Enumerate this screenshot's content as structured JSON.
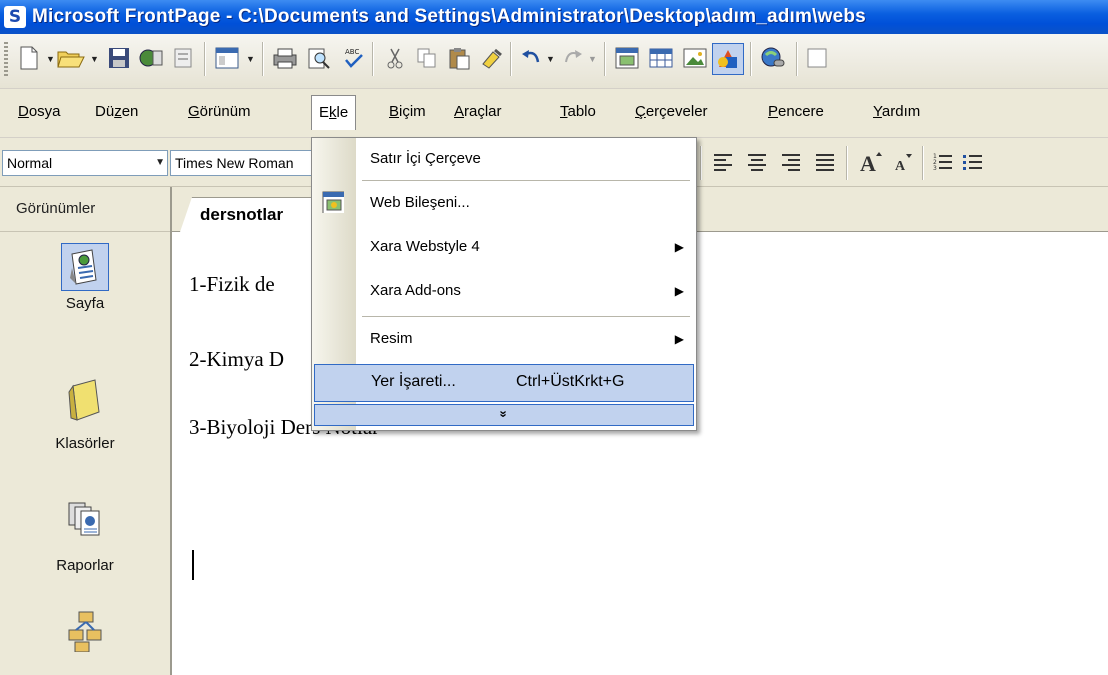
{
  "window": {
    "title": "Microsoft FrontPage - C:\\Documents and Settings\\Administrator\\Desktop\\adım_adım\\webs"
  },
  "menubar": {
    "items": [
      {
        "label": "Dosya",
        "u": "D"
      },
      {
        "label": "Düzen",
        "u": "z"
      },
      {
        "label": "Görünüm",
        "u": "G"
      },
      {
        "label": "Ekle",
        "u": "k"
      },
      {
        "label": "Biçim",
        "u": "B"
      },
      {
        "label": "Araçlar",
        "u": "A"
      },
      {
        "label": "Tablo",
        "u": "T"
      },
      {
        "label": "Çerçeveler",
        "u": "Ç"
      },
      {
        "label": "Pencere",
        "u": "P"
      },
      {
        "label": "Yardım",
        "u": "Y"
      }
    ]
  },
  "format_toolbar": {
    "style_value": "Normal",
    "font_value": "Times New Roman"
  },
  "views_panel": {
    "header": "Görünümler",
    "items": [
      {
        "label": "Sayfa",
        "icon": "page-view-icon"
      },
      {
        "label": "Klasörler",
        "icon": "folder-icon"
      },
      {
        "label": "Raporlar",
        "icon": "reports-icon"
      },
      {
        "label": "",
        "icon": "navigation-icon"
      }
    ]
  },
  "document": {
    "tab_label": "dersnotlar",
    "lines": [
      "1-Fizik de",
      "2-Kimya D",
      "3-Biyoloji Ders Notlar"
    ]
  },
  "insert_menu": {
    "items": [
      {
        "label": "Satır İçi Çerçeve",
        "submenu": false
      },
      {
        "label": "Web Bileşeni...",
        "submenu": false,
        "icon": "web-component-icon"
      },
      {
        "label": "Xara Webstyle 4",
        "submenu": true
      },
      {
        "label": "Xara Add-ons",
        "submenu": true
      },
      {
        "label": "Resim",
        "submenu": true
      },
      {
        "label": "Yer İşareti...",
        "shortcut": "Ctrl+ÜstKrkt+G",
        "submenu": false,
        "highlighted": true
      }
    ],
    "expand_glyph": "»"
  },
  "colors": {
    "titlebar": "#0a5fe0",
    "menu_highlight": "#c1d2ee",
    "menu_highlight_border": "#316ac5"
  }
}
